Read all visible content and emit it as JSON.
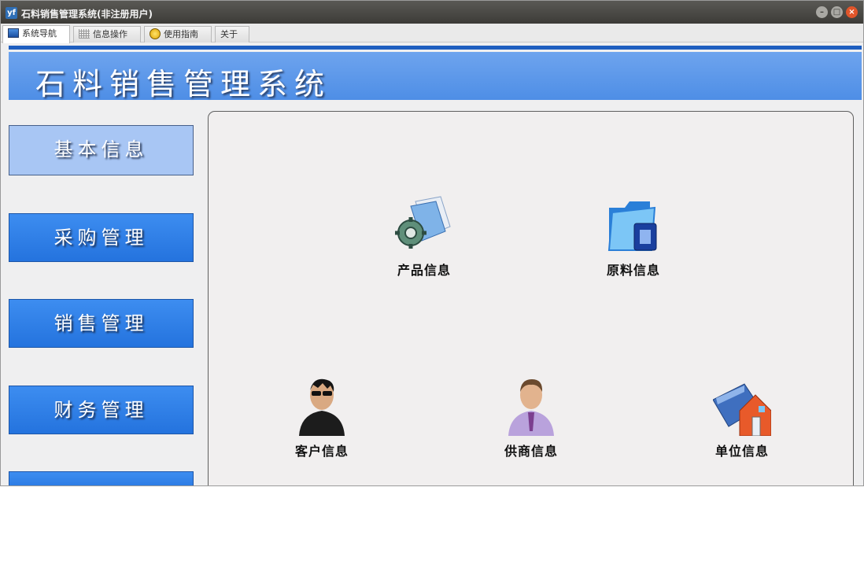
{
  "window": {
    "title": "石料销售管理系统(非注册用户)",
    "app_icon_text": "yf",
    "minimize_glyph": "–",
    "maximize_glyph": "□",
    "close_glyph": "×"
  },
  "tabs": [
    {
      "label": "系统导航",
      "icon": "monitor-icon",
      "active": true
    },
    {
      "label": "信息操作",
      "icon": "grid-icon",
      "active": false
    },
    {
      "label": "使用指南",
      "icon": "lightbulb-icon",
      "active": false
    },
    {
      "label": "关于",
      "icon": "",
      "active": false
    }
  ],
  "banner": {
    "title": "石料销售管理系统"
  },
  "sidebar": {
    "items": [
      {
        "label": "基本信息",
        "active": true
      },
      {
        "label": "采购管理",
        "active": false
      },
      {
        "label": "销售管理",
        "active": false
      },
      {
        "label": "财务管理",
        "active": false
      }
    ]
  },
  "main": {
    "tiles": [
      {
        "label": "产品信息",
        "icon": "product-gear-document-icon"
      },
      {
        "label": "原料信息",
        "icon": "blue-folder-icon"
      },
      {
        "label": "客户信息",
        "icon": "person-sunglasses-icon"
      },
      {
        "label": "供商信息",
        "icon": "businessman-icon"
      },
      {
        "label": "单位信息",
        "icon": "house-book-icon"
      }
    ]
  },
  "colors": {
    "banner_blue": "#4e8ee6",
    "nav_blue": "#2f80e8",
    "nav_active": "#a8c6f4",
    "close_button": "#e0552a"
  }
}
